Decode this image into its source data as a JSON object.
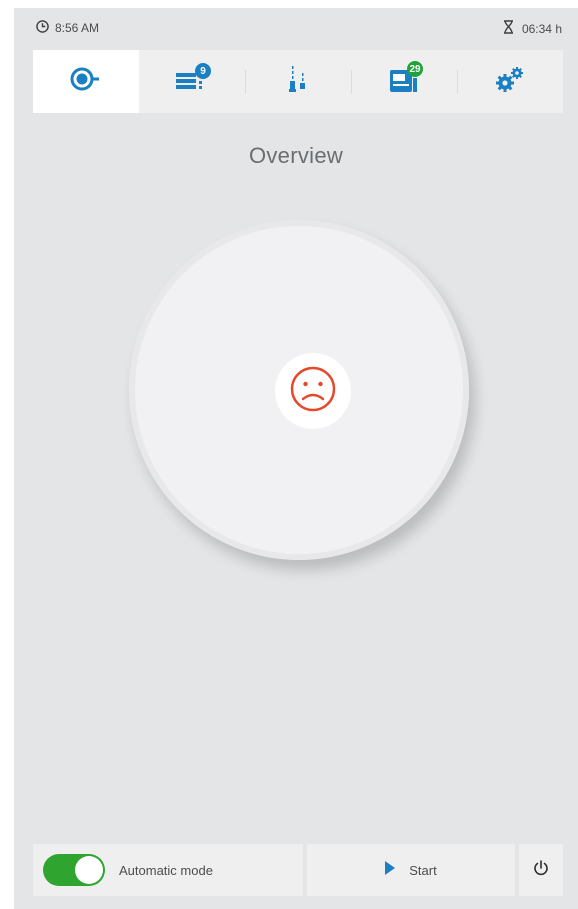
{
  "status": {
    "time": "8:56 AM",
    "runtime": "06:34 h"
  },
  "nav": {
    "tabs": [
      {
        "name": "overview",
        "icon": "overview-icon"
      },
      {
        "name": "messages",
        "icon": "list-info-icon",
        "badge": "9"
      },
      {
        "name": "process",
        "icon": "process-icon"
      },
      {
        "name": "device",
        "icon": "device-icon",
        "badge": "29"
      },
      {
        "name": "settings",
        "icon": "gears-icon"
      }
    ]
  },
  "main": {
    "title": "Overview",
    "state_icon": "sad-face-icon"
  },
  "bottom": {
    "auto_label": "Automatic mode",
    "auto_on": true,
    "start_label": "Start"
  },
  "colors": {
    "accent": "#1b7fc4",
    "error": "#e8472a",
    "toggle": "#2fa52f",
    "badge_green": "#1ea33b"
  }
}
